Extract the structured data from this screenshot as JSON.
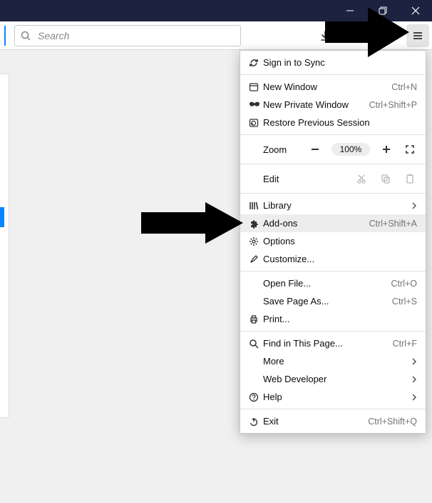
{
  "search": {
    "placeholder": "Search"
  },
  "zoom": {
    "label": "Zoom",
    "percent": "100%"
  },
  "edit": {
    "label": "Edit"
  },
  "items": {
    "signin": {
      "label": "Sign in to Sync"
    },
    "newwin": {
      "label": "New Window",
      "accel": "Ctrl+N"
    },
    "newpriv": {
      "label": "New Private Window",
      "accel": "Ctrl+Shift+P"
    },
    "restore": {
      "label": "Restore Previous Session"
    },
    "library": {
      "label": "Library"
    },
    "addons": {
      "label": "Add-ons",
      "accel": "Ctrl+Shift+A"
    },
    "options": {
      "label": "Options"
    },
    "customize": {
      "label": "Customize..."
    },
    "openfile": {
      "label": "Open File...",
      "accel": "Ctrl+O"
    },
    "savepage": {
      "label": "Save Page As...",
      "accel": "Ctrl+S"
    },
    "print": {
      "label": "Print..."
    },
    "find": {
      "label": "Find in This Page...",
      "accel": "Ctrl+F"
    },
    "more": {
      "label": "More"
    },
    "webdev": {
      "label": "Web Developer"
    },
    "help": {
      "label": "Help"
    },
    "exit": {
      "label": "Exit",
      "accel": "Ctrl+Shift+Q"
    }
  }
}
